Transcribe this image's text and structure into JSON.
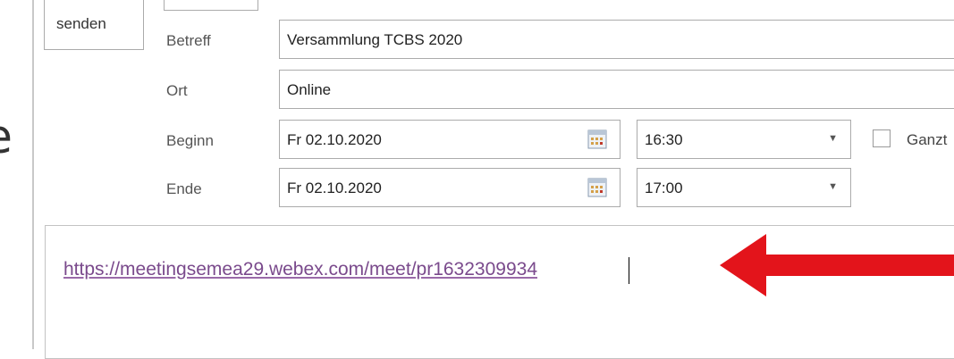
{
  "toolbar": {
    "send_label": "senden"
  },
  "labels": {
    "subject": "Betreff",
    "location": "Ort",
    "start": "Beginn",
    "end": "Ende"
  },
  "values": {
    "subject": "Versammlung TCBS 2020",
    "location": "Online",
    "start_date": "Fr 02.10.2020",
    "start_time": "16:30",
    "end_date": "Fr 02.10.2020",
    "end_time": "17:00"
  },
  "all_day": {
    "label": "Ganzt",
    "checked": false
  },
  "body": {
    "link": "https://meetingsemea29.webex.com/meet/pr1632309934"
  },
  "side": {
    "letter": "e"
  },
  "colors": {
    "link": "#7a4a8c",
    "arrow": "#e3141b",
    "border": "#ababab"
  },
  "icons": [
    "calendar-icon",
    "chevron-down-icon",
    "red-arrow-annotation"
  ]
}
